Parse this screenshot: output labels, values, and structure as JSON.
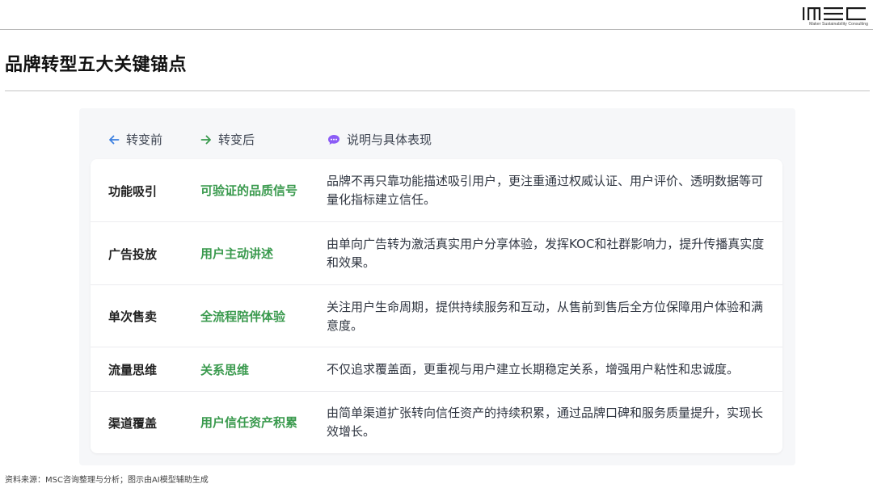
{
  "logo": {
    "tagline": "Maker Sustainability Consulting"
  },
  "page": {
    "title": "品牌转型五大关键锚点"
  },
  "table": {
    "header_before": "转变前",
    "header_after": "转变后",
    "header_desc": "说明与具体表现",
    "rows": [
      {
        "before": "功能吸引",
        "after": "可验证的品质信号",
        "desc": "品牌不再只靠功能描述吸引用户，更注重通过权威认证、用户评价、透明数据等可量化指标建立信任。"
      },
      {
        "before": "广告投放",
        "after": "用户主动讲述",
        "desc": "由单向广告转为激活真实用户分享体验，发挥KOC和社群影响力，提升传播真实度和效果。"
      },
      {
        "before": "单次售卖",
        "after": "全流程陪伴体验",
        "desc": "关注用户生命周期，提供持续服务和互动，从售前到售后全方位保障用户体验和满意度。"
      },
      {
        "before": "流量思维",
        "after": "关系思维",
        "desc": "不仅追求覆盖面，更重视与用户建立长期稳定关系，增强用户粘性和忠诚度。"
      },
      {
        "before": "渠道覆盖",
        "after": "用户信任资产积累",
        "desc": "由简单渠道扩张转向信任资产的持续积累，通过品牌口碑和服务质量提升，实现长效增长。"
      }
    ]
  },
  "footer": {
    "source": "资料来源：MSC咨询整理与分析；图示由AI模型辅助生成"
  },
  "colors": {
    "accent_green": "#3a9a4e",
    "arrow_blue": "#3b7fe0",
    "chat_purple": "#8b5cf6"
  },
  "icons": {
    "before": "arrow-left-icon",
    "after": "arrow-right-icon",
    "desc": "chat-bubble-icon"
  }
}
